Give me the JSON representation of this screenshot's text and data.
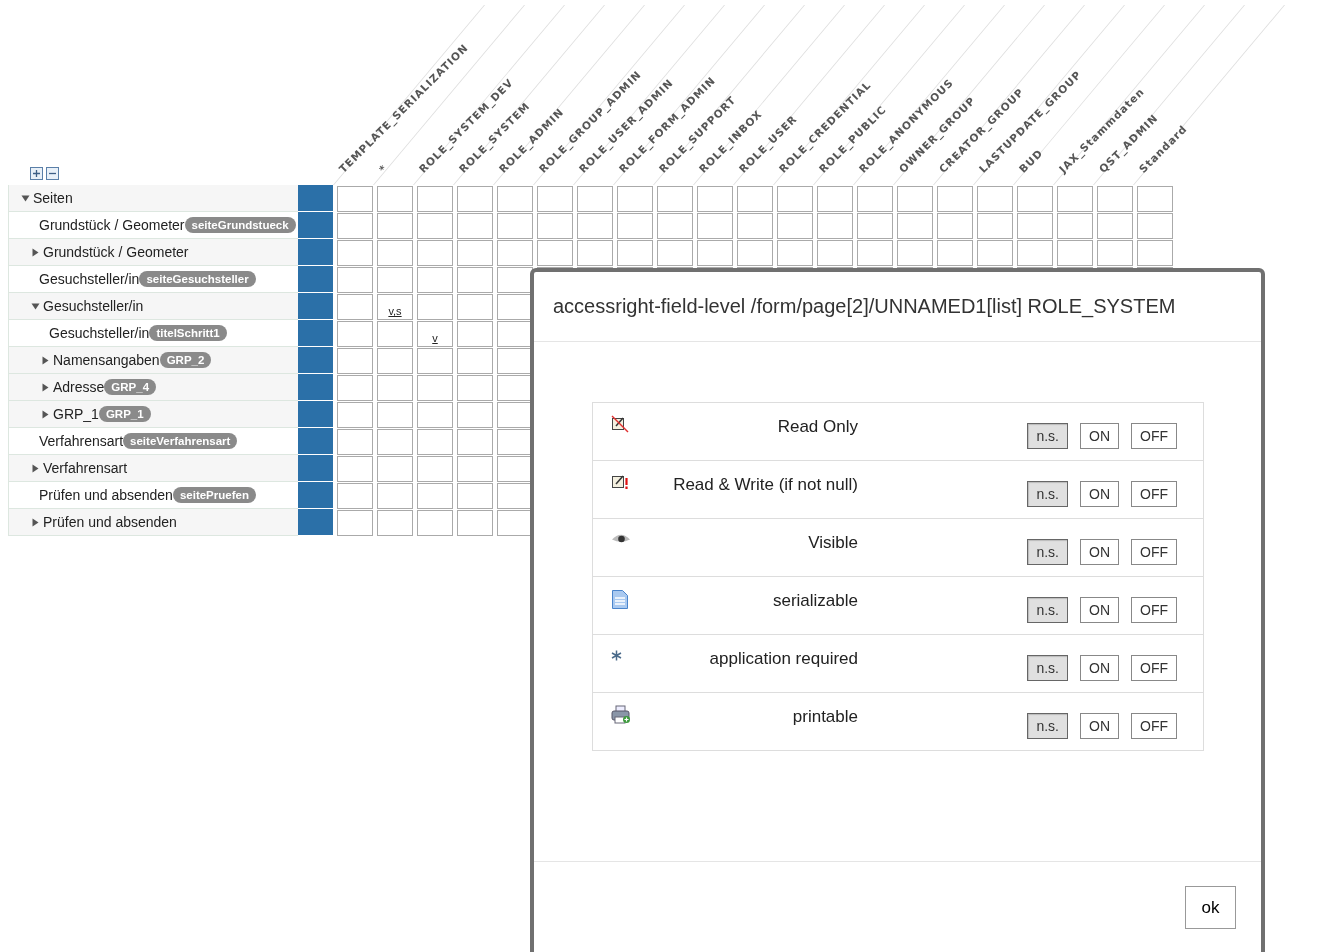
{
  "columns": [
    {
      "label": "TEMPLATE_SERIALIZATION"
    },
    {
      "label": "*"
    },
    {
      "label": "ROLE_SYSTEM_DEV"
    },
    {
      "label": "ROLE_SYSTEM"
    },
    {
      "label": "ROLE_ADMIN"
    },
    {
      "label": "ROLE_GROUP_ADMIN"
    },
    {
      "label": "ROLE_USER_ADMIN"
    },
    {
      "label": "ROLE_FORM_ADMIN"
    },
    {
      "label": "ROLE_SUPPORT"
    },
    {
      "label": "ROLE_INBOX"
    },
    {
      "label": "ROLE_USER"
    },
    {
      "label": "ROLE_CREDENTIAL"
    },
    {
      "label": "ROLE_PUBLIC"
    },
    {
      "label": "ROLE_ANONYMOUS"
    },
    {
      "label": "OWNER_GROUP"
    },
    {
      "label": "CREATOR_GROUP"
    },
    {
      "label": "LASTUPDATE_GROUP"
    },
    {
      "label": "BUD"
    },
    {
      "label": "JAX_Stammdaten"
    },
    {
      "label": "QST_ADMIN"
    },
    {
      "label": "Standard"
    }
  ],
  "tree": [
    {
      "label": "Seiten",
      "expanded": true,
      "children": [
        {
          "label": "Grundstück / Geometer",
          "badge": "seiteGrundstueck"
        },
        {
          "label": "Grundstück / Geometer",
          "expanded": false
        },
        {
          "label": "Gesuchsteller/in",
          "badge": "seiteGesuchsteller"
        },
        {
          "label": "Gesuchsteller/in",
          "expanded": true,
          "cells": [
            null,
            "v,s"
          ],
          "children": [
            {
              "label": "Gesuchsteller/in",
              "badge": "titelSchritt1",
              "cells": [
                null,
                null,
                "v"
              ]
            },
            {
              "label": "Namensangaben",
              "badge": "GRP_2",
              "expanded": false
            },
            {
              "label": "Adresse",
              "badge": "GRP_4",
              "expanded": false
            },
            {
              "label": "GRP_1",
              "badge": "GRP_1",
              "expanded": false
            }
          ]
        },
        {
          "label": "Verfahrensart",
          "badge": "seiteVerfahrensart"
        },
        {
          "label": "Verfahrensart",
          "expanded": false
        },
        {
          "label": "Prüfen und absenden",
          "badge": "seitePruefen"
        },
        {
          "label": "Prüfen und absenden",
          "expanded": false
        }
      ]
    }
  ],
  "dialog": {
    "title": "accessright-field-level /form/page[2]/UNNAMED1[list] ROLE_SYSTEM",
    "options": [
      {
        "kind": "read_only",
        "label": "Read Only",
        "states": [
          {
            "label": "n.s.",
            "selected": true
          },
          {
            "label": "ON",
            "selected": false
          },
          {
            "label": "OFF",
            "selected": false
          }
        ]
      },
      {
        "kind": "read_write",
        "label": "Read & Write (if not null)",
        "states": [
          {
            "label": "n.s.",
            "selected": true
          },
          {
            "label": "ON",
            "selected": false
          },
          {
            "label": "OFF",
            "selected": false
          }
        ]
      },
      {
        "kind": "visible",
        "label": "Visible",
        "states": [
          {
            "label": "n.s.",
            "selected": true
          },
          {
            "label": "ON",
            "selected": false
          },
          {
            "label": "OFF",
            "selected": false
          }
        ]
      },
      {
        "kind": "serializable",
        "label": "serializable",
        "states": [
          {
            "label": "n.s.",
            "selected": true
          },
          {
            "label": "ON",
            "selected": false
          },
          {
            "label": "OFF",
            "selected": false
          }
        ]
      },
      {
        "kind": "required",
        "label": "application required",
        "states": [
          {
            "label": "n.s.",
            "selected": true
          },
          {
            "label": "ON",
            "selected": false
          },
          {
            "label": "OFF",
            "selected": false
          }
        ]
      },
      {
        "kind": "printable",
        "label": "printable",
        "states": [
          {
            "label": "n.s.",
            "selected": true
          },
          {
            "label": "ON",
            "selected": false
          },
          {
            "label": "OFF",
            "selected": false
          }
        ]
      }
    ],
    "ok_button": "ok"
  }
}
